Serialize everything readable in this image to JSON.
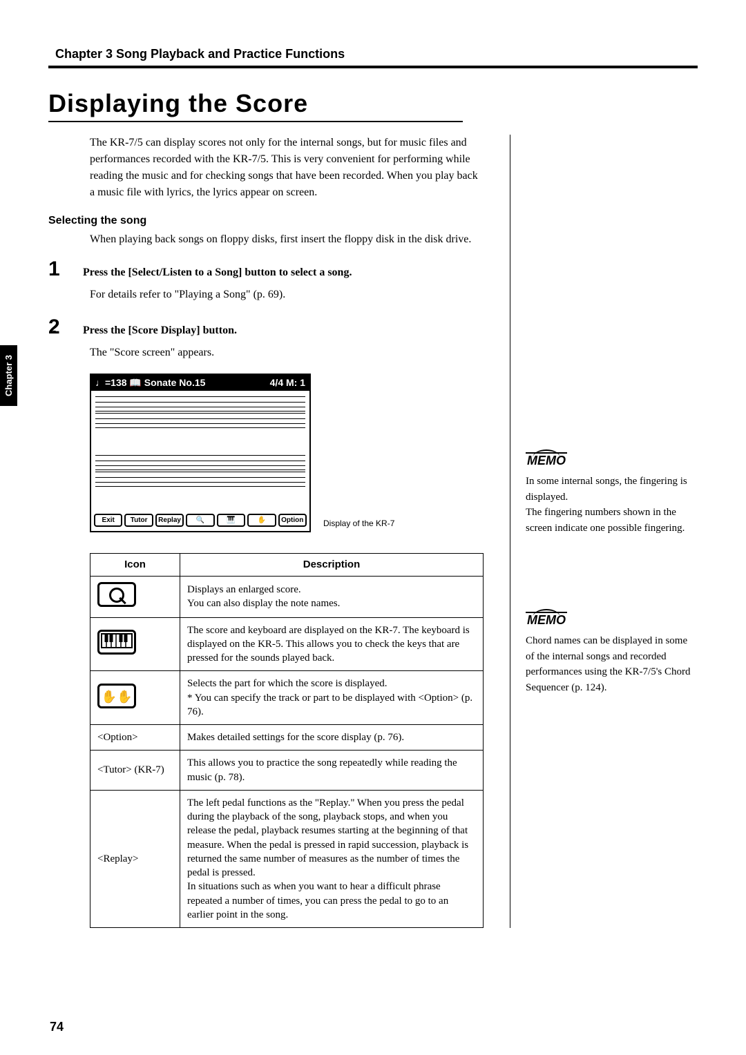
{
  "header": {
    "chapter_line": "Chapter 3 Song Playback and Practice Functions",
    "tab": "Chapter 3"
  },
  "title": "Displaying the Score",
  "intro": "The KR-7/5 can display scores not only for the internal songs, but for music files and performances recorded with the KR-7/5. This is very convenient for performing while reading the music and for checking songs that have been recorded. When you play back a music file with lyrics, the lyrics appear on screen.",
  "section": {
    "heading": "Selecting the song",
    "text": "When playing back songs on floppy disks, first insert the floppy disk in the disk drive."
  },
  "steps": [
    {
      "num": "1",
      "title": "Press the [Select/Listen to a Song] button to select a song.",
      "body": "For details refer to \"Playing a Song\" (p. 69)."
    },
    {
      "num": "2",
      "title": "Press the [Score Display] button.",
      "body": "The \"Score screen\" appears."
    }
  ],
  "screenshot": {
    "top_left": "♩=138 📖 Sonate No.15",
    "top_right": "4/4  M:   1",
    "buttons": [
      "Exit",
      "Tutor",
      "Replay",
      "🔍",
      "🎹",
      "✋",
      "Option"
    ],
    "caption": "Display of the KR-7"
  },
  "table": {
    "headers": [
      "Icon",
      "Description"
    ],
    "rows": [
      {
        "icon": "magnify",
        "label": "",
        "desc": "Displays an enlarged score.\nYou can also display the note names."
      },
      {
        "icon": "keyboard",
        "label": "",
        "desc": "The score and keyboard are displayed on the KR-7. The keyboard is displayed on the KR-5. This allows you to check the keys that are pressed for the sounds played back."
      },
      {
        "icon": "hands",
        "label": "",
        "desc": "Selects the part for which the score is displayed.\n* You can specify the track or part to be displayed with <Option> (p. 76)."
      },
      {
        "icon": "",
        "label": "<Option>",
        "desc": "Makes detailed settings for the score display (p. 76)."
      },
      {
        "icon": "",
        "label": "<Tutor> (KR-7)",
        "desc": "This allows you to practice the song repeatedly while reading the music (p. 78)."
      },
      {
        "icon": "",
        "label": "<Replay>",
        "desc": "The left pedal functions as the \"Replay.\" When you press the pedal during the playback of the song, playback stops, and when you release the pedal, playback resumes starting at the beginning of that measure. When the pedal is pressed in rapid succession, playback is returned the same number of measures as the number of times the pedal is pressed.\nIn situations such as when you want to hear a difficult phrase repeated a number of times, you can press the pedal to go to an earlier point in the song."
      }
    ]
  },
  "memos": [
    {
      "label": "MEMO",
      "text": "In some internal songs, the fingering is displayed.\nThe fingering numbers shown in the screen indicate one possible fingering."
    },
    {
      "label": "MEMO",
      "text": "Chord names can be displayed in some of the internal songs and recorded performances using the KR-7/5's Chord Sequencer (p. 124)."
    }
  ],
  "page_number": "74"
}
